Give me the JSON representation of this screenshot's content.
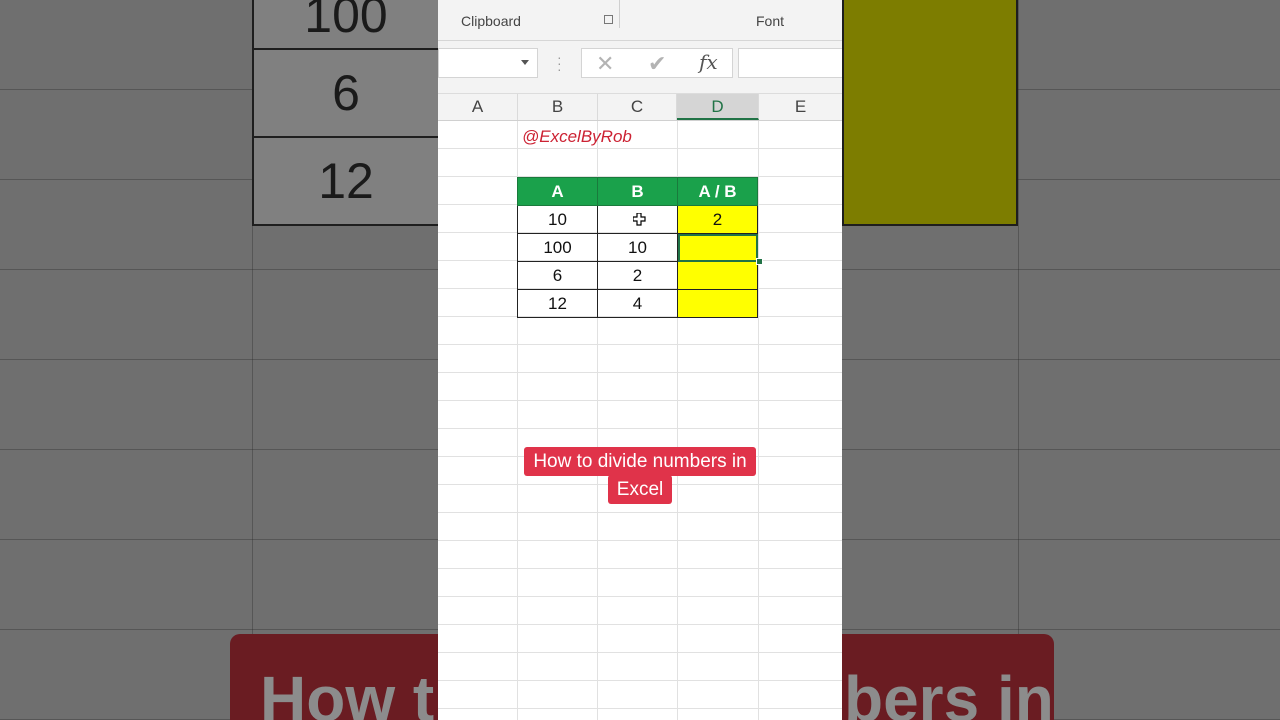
{
  "ribbon": {
    "clipboard_label": "Clipboard",
    "font_label": "Font"
  },
  "formula_bar": {
    "name_box_value": "",
    "cancel_icon": "✕",
    "enter_icon": "✔",
    "fx_label": "fx",
    "formula_value": ""
  },
  "columns": [
    "A",
    "B",
    "C",
    "D",
    "E"
  ],
  "selected_column": "D",
  "watermark": "@ExcelByRob",
  "table": {
    "headers": [
      "A",
      "B",
      "A / B"
    ],
    "rows": [
      [
        "10",
        "",
        "2"
      ],
      [
        "100",
        "10",
        ""
      ],
      [
        "6",
        "2",
        ""
      ],
      [
        "12",
        "4",
        ""
      ]
    ]
  },
  "caption": {
    "line1": "How to divide numbers in",
    "line2": "Excel"
  },
  "background": {
    "values": [
      "100",
      "6",
      "12"
    ],
    "banner_left": "How t",
    "banner_right": "bers in"
  },
  "colors": {
    "header_green": "#1aa14b",
    "result_yellow": "#ffff00",
    "caption_red": "#e0334a",
    "excel_green": "#217346"
  }
}
